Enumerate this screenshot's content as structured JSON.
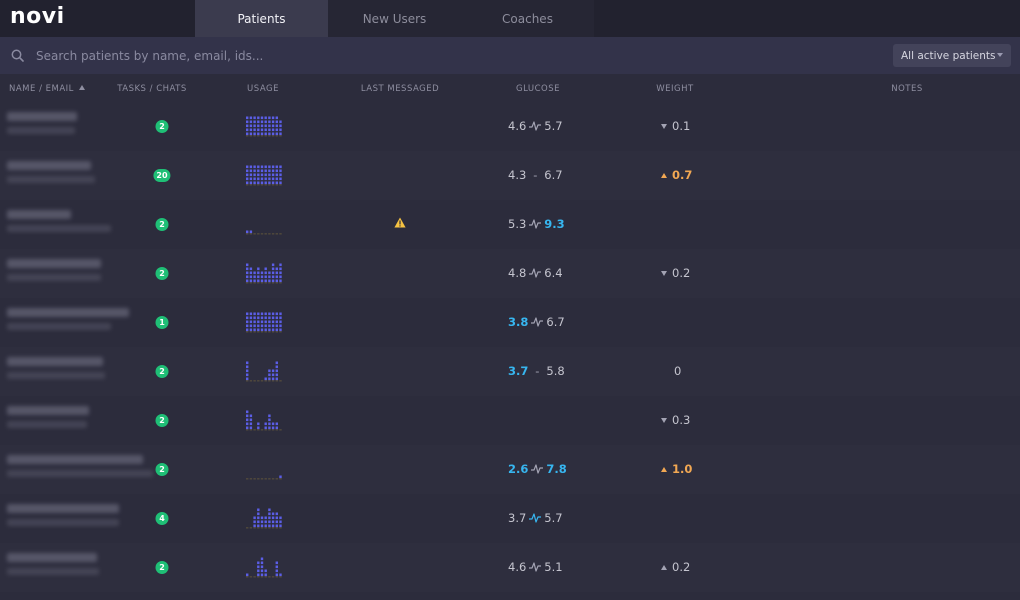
{
  "app": {
    "logo": "novi"
  },
  "tabs": [
    {
      "label": "Patients",
      "active": true
    },
    {
      "label": "New Users",
      "active": false
    },
    {
      "label": "Coaches",
      "active": false
    }
  ],
  "search": {
    "placeholder": "Search patients by name, email, ids..."
  },
  "filter": {
    "selected": "All active patients"
  },
  "columns": {
    "name_email": "NAME / EMAIL",
    "tasks_chats": "TASKS / CHATS",
    "usage": "USAGE",
    "last_messaged": "LAST MESSAGED",
    "glucose": "GLUCOSE",
    "weight": "WEIGHT",
    "notes": "NOTES"
  },
  "colors": {
    "accent_green": "#1fbf76",
    "glucose_low_blue": "#37b6f0",
    "weight_up_orange": "#f2a853",
    "usage_bar": "#5b5ee6",
    "warning": "#f5c242"
  },
  "rows": [
    {
      "tasks": "2",
      "usage": [
        5,
        5,
        5,
        5,
        5,
        5,
        5,
        5,
        5,
        4
      ],
      "warning": false,
      "glucose_low": "4.6",
      "glucose_high": "5.7",
      "sep": "spark",
      "low_flag": false,
      "high_flag": false,
      "weight_dir": "down",
      "weight": "0.1"
    },
    {
      "tasks": "20",
      "usage": [
        5,
        5,
        5,
        5,
        5,
        5,
        5,
        5,
        5,
        5
      ],
      "warning": false,
      "glucose_low": "4.3",
      "glucose_high": "6.7",
      "sep": "dash",
      "low_flag": false,
      "high_flag": false,
      "weight_dir": "up",
      "weight": "0.7"
    },
    {
      "tasks": "2",
      "usage": [
        1,
        1,
        0,
        0,
        0,
        0,
        0,
        0,
        0,
        0
      ],
      "warning": true,
      "glucose_low": "5.3",
      "glucose_high": "9.3",
      "sep": "spark",
      "low_flag": false,
      "high_flag": true,
      "weight_dir": "none",
      "weight": ""
    },
    {
      "tasks": "2",
      "usage": [
        5,
        4,
        3,
        4,
        3,
        4,
        3,
        5,
        4,
        5
      ],
      "warning": false,
      "glucose_low": "4.8",
      "glucose_high": "6.4",
      "sep": "spark",
      "low_flag": false,
      "high_flag": false,
      "weight_dir": "down",
      "weight": "0.2"
    },
    {
      "tasks": "1",
      "usage": [
        5,
        5,
        5,
        5,
        5,
        5,
        5,
        5,
        5,
        5
      ],
      "warning": false,
      "glucose_low": "3.8",
      "glucose_high": "6.7",
      "sep": "spark",
      "low_flag": true,
      "high_flag": false,
      "weight_dir": "none",
      "weight": ""
    },
    {
      "tasks": "2",
      "usage": [
        5,
        0,
        0,
        0,
        0,
        1,
        3,
        3,
        5,
        0
      ],
      "warning": false,
      "glucose_low": "3.7",
      "glucose_high": "5.8",
      "sep": "dash",
      "low_flag": true,
      "high_flag": false,
      "weight_dir": "flat",
      "weight": "0"
    },
    {
      "tasks": "2",
      "usage": [
        5,
        4,
        0,
        2,
        0,
        2,
        4,
        2,
        2,
        0
      ],
      "warning": false,
      "glucose_low": "",
      "glucose_high": "",
      "sep": "none",
      "low_flag": false,
      "high_flag": false,
      "weight_dir": "down",
      "weight": "0.3"
    },
    {
      "tasks": "2",
      "usage": [
        0,
        0,
        0,
        0,
        0,
        0,
        0,
        0,
        0,
        1
      ],
      "warning": false,
      "glucose_low": "2.6",
      "glucose_high": "7.8",
      "sep": "spark",
      "low_flag": true,
      "high_flag": true,
      "weight_dir": "up",
      "weight": "1.0"
    },
    {
      "tasks": "4",
      "usage": [
        0,
        0,
        3,
        5,
        3,
        3,
        5,
        4,
        4,
        3
      ],
      "warning": false,
      "glucose_low": "3.7",
      "glucose_high": "5.7",
      "sep": "spark-blue",
      "low_flag": false,
      "high_flag": false,
      "weight_dir": "none",
      "weight": ""
    },
    {
      "tasks": "2",
      "usage": [
        1,
        0,
        0,
        4,
        5,
        2,
        0,
        0,
        4,
        1
      ],
      "warning": false,
      "glucose_low": "4.6",
      "glucose_high": "5.1",
      "sep": "spark",
      "low_flag": false,
      "high_flag": false,
      "weight_dir": "up-gray",
      "weight": "0.2"
    }
  ]
}
